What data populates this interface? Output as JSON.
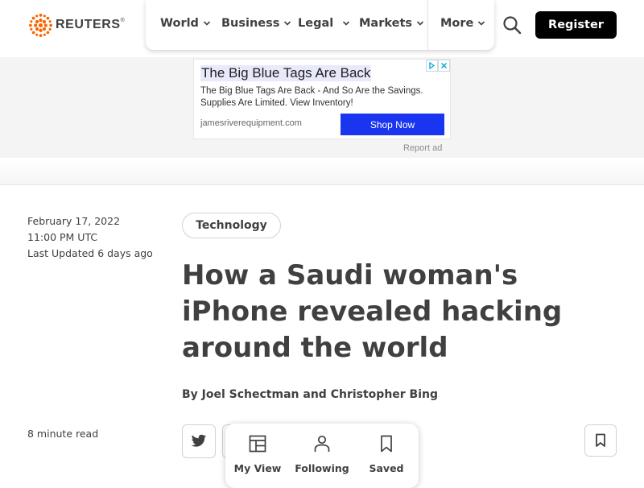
{
  "brand": {
    "name": "REUTERS",
    "trademark": "®"
  },
  "nav": {
    "items": [
      {
        "label": "World"
      },
      {
        "label": "Business"
      },
      {
        "label": "Legal"
      },
      {
        "label": "Markets"
      },
      {
        "label": "More"
      }
    ],
    "search_icon": "search-icon",
    "register_label": "Register"
  },
  "ad": {
    "title": "The Big Blue Tags Are Back",
    "description": "The Big Blue Tags Are Back - And So Are the Savings. Supplies Are Limited. View Inventory!",
    "domain": "jamesriverequipment.com",
    "cta": "Shop Now",
    "report_label": "Report ad"
  },
  "article": {
    "date": "February 17, 2022",
    "time": "11:00 PM UTC",
    "updated": "Last Updated 6 days ago",
    "category": "Technology",
    "headline": "How a Saudi woman's iPhone revealed hacking around the world",
    "byline_prefix": "By",
    "author_1": "Joel Schectman",
    "byline_and": "and",
    "author_2": "Christopher Bing",
    "read_time": "8 minute read"
  },
  "dock": {
    "items": [
      {
        "label": "My View",
        "icon": "layout-icon"
      },
      {
        "label": "Following",
        "icon": "person-icon"
      },
      {
        "label": "Saved",
        "icon": "bookmark-icon"
      }
    ]
  },
  "colors": {
    "text": "#404040",
    "register_bg": "#000000",
    "ad_cta_bg": "#1a35f0",
    "ad_band_bg": "#f4f4f4",
    "logo_orange": "#fa6400"
  }
}
